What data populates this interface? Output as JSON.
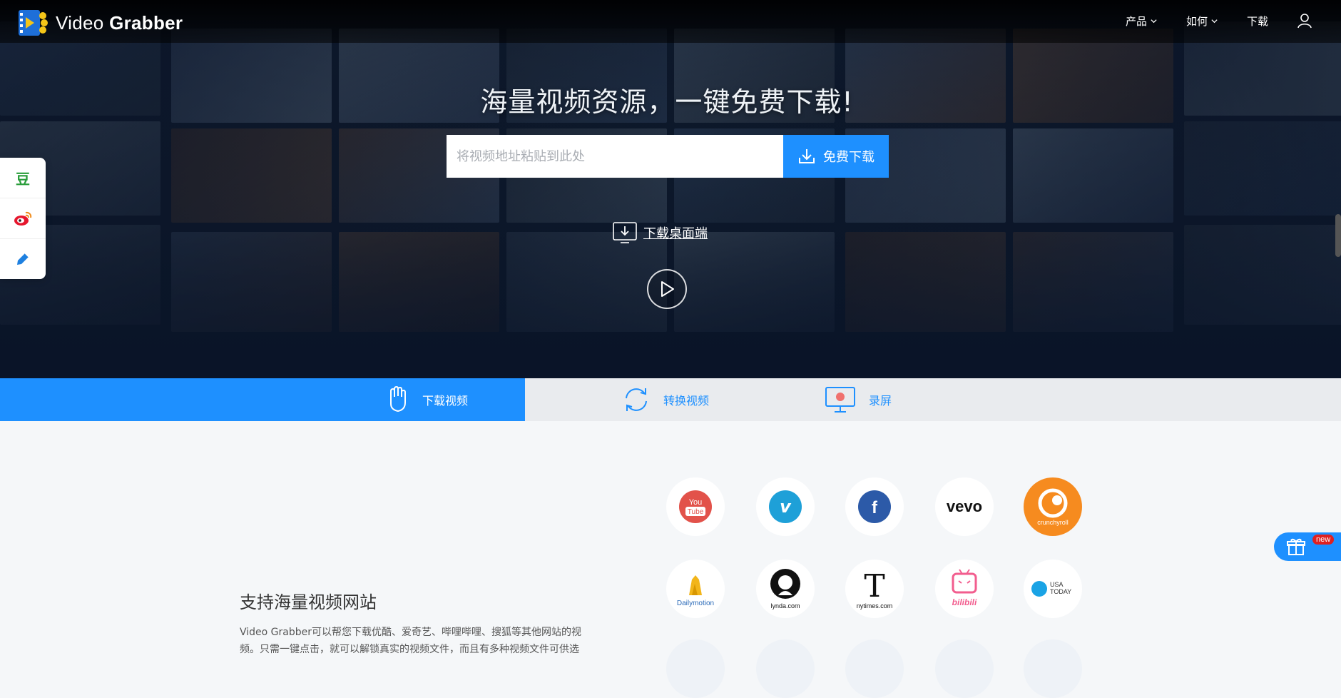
{
  "header": {
    "brand_light": "Video ",
    "brand_bold": "Grabber",
    "nav": [
      {
        "label": "产品",
        "has_dropdown": true
      },
      {
        "label": "如何",
        "has_dropdown": true
      },
      {
        "label": "下载",
        "has_dropdown": false
      }
    ]
  },
  "hero": {
    "headline": "海量视频资源，一键免费下载!",
    "search": {
      "placeholder": "将视频地址粘贴到此处",
      "value": ""
    },
    "download_button": "免费下载",
    "desktop_link": "下载桌面端"
  },
  "tabs": [
    {
      "label": "下载视频",
      "active": true
    },
    {
      "label": "转换视频",
      "active": false
    },
    {
      "label": "录屏",
      "active": false
    }
  ],
  "features": {
    "title": "支持海量视频网站",
    "description": "Video Grabber可以帮您下载优酷、爱奇艺、哔哩哔哩、搜狐等其他网站的视频。只需一键点击，就可以解锁真实的视频文件，而且有多种视频文件可供选"
  },
  "sites": [
    {
      "name": "YouTube",
      "color": "#e2524a",
      "icon": "youtube-icon",
      "line1": "You",
      "line2": "Tube"
    },
    {
      "name": "Vimeo",
      "color": "#1ea0d8",
      "icon": "vimeo-icon",
      "glyph": "v"
    },
    {
      "name": "Facebook",
      "color": "#2c5aa8",
      "icon": "facebook-icon",
      "glyph": "f"
    },
    {
      "name": "Vevo",
      "color": "#111111",
      "icon": "vevo-icon",
      "glyph": "vevo"
    },
    {
      "name": "Crunchyroll",
      "color": "#f68b1f",
      "icon": "crunchyroll-icon",
      "glyph": "crunchyroll"
    },
    {
      "name": "Dailymotion",
      "color": "#f2b51a",
      "icon": "dailymotion-icon",
      "caption": "Dailymotion"
    },
    {
      "name": "lynda.com",
      "color": "#111111",
      "icon": "lynda-icon",
      "caption": "lynda.com"
    },
    {
      "name": "nytimes.com",
      "color": "#111111",
      "icon": "nytimes-icon",
      "caption": "nytimes.com",
      "glyph": "T"
    },
    {
      "name": "bilibili",
      "color": "#f25d8e",
      "icon": "bilibili-icon",
      "caption": "bilibili"
    },
    {
      "name": "USA TODAY",
      "color": "#1aa3e5",
      "icon": "usatoday-icon",
      "line1": "USA",
      "line2": "TODAY"
    }
  ],
  "gift": {
    "badge": "new",
    "icon": "gift-icon"
  },
  "social": [
    {
      "icon": "douban-icon",
      "glyph": "豆"
    },
    {
      "icon": "weibo-icon"
    },
    {
      "icon": "edit-icon"
    }
  ],
  "colors": {
    "accent": "#1e90ff",
    "hero_bg": "#0f1a2b",
    "page_bg": "#f5f7f9"
  }
}
